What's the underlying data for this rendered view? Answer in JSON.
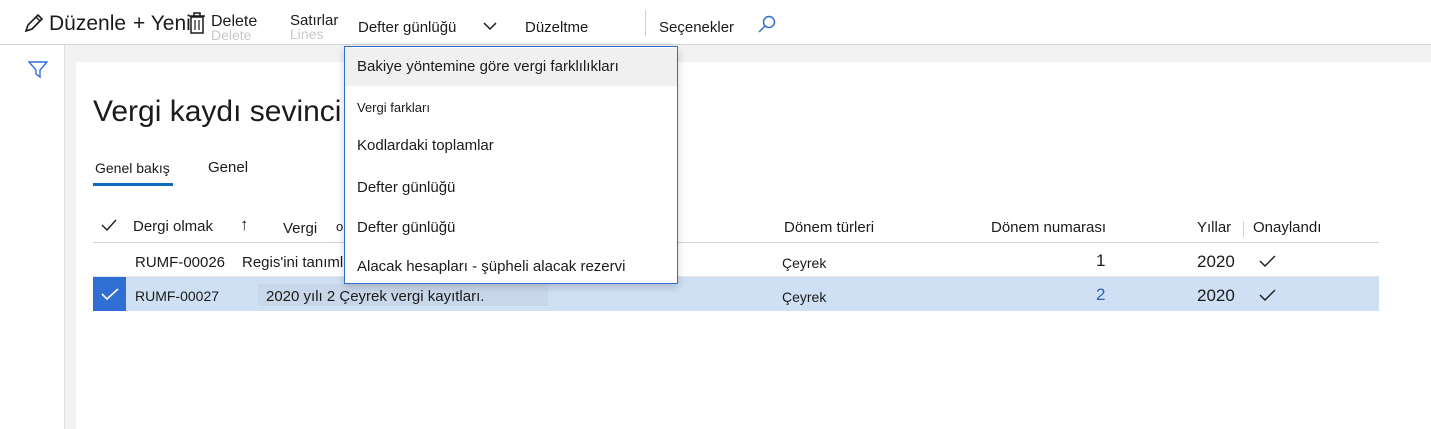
{
  "toolbar": {
    "edit_label": "Düzenle",
    "new_label": "+ Yeni",
    "delete_label": "Delete",
    "delete_ghost_label": "Delete",
    "lines_label": "Satırlar",
    "lines_ghost_label": "Lines",
    "journal_label": "Defter günlüğü",
    "correction_label": "Düzeltme",
    "options_label": "Seçenekler"
  },
  "page": {
    "title": "Vergi kaydı sevinci",
    "tabs": [
      {
        "label": "Genel bakış",
        "selected": true
      },
      {
        "label": "Genel",
        "selected": false
      }
    ]
  },
  "grid": {
    "columns": {
      "journal": "Dergi olmak",
      "sort_arrow": "↑",
      "tax": "Vergi",
      "tax_suffix": "o",
      "period_types": "Dönem türleri",
      "period_number": "Dönem numarası",
      "years": "Yıllar",
      "approved": "Onaylandı"
    },
    "rows": [
      {
        "journal": "RUMF-00026",
        "description": "Regis'ini tanımla",
        "period_type": "Çeyrek",
        "period_number": "1",
        "year": "2020",
        "approved": true,
        "selected": false
      },
      {
        "journal": "RUMF-00027",
        "description": "2020 yılı 2 Çeyrek vergi kayıtları.",
        "period_type": "Çeyrek",
        "period_number": "2",
        "year": "2020",
        "approved": true,
        "selected": true
      }
    ]
  },
  "menu": {
    "items": [
      "Bakiye yöntemine göre vergi farklılıkları",
      "Vergi farkları",
      "Kodlardaki toplamlar",
      "Defter günlüğü",
      "Defter günlüğü",
      "Alacak hesapları - şüpheli alacak rezervi"
    ]
  },
  "colors": {
    "accent": "#0f6cbd",
    "selection_row": "#cfe0f4",
    "selection_check": "#2f6fd3",
    "link_number": "#2f5fb3"
  },
  "icons": [
    "pencil-icon",
    "trash-icon",
    "chevron-down-icon",
    "search-icon",
    "filter-icon",
    "checkmark-icon"
  ]
}
